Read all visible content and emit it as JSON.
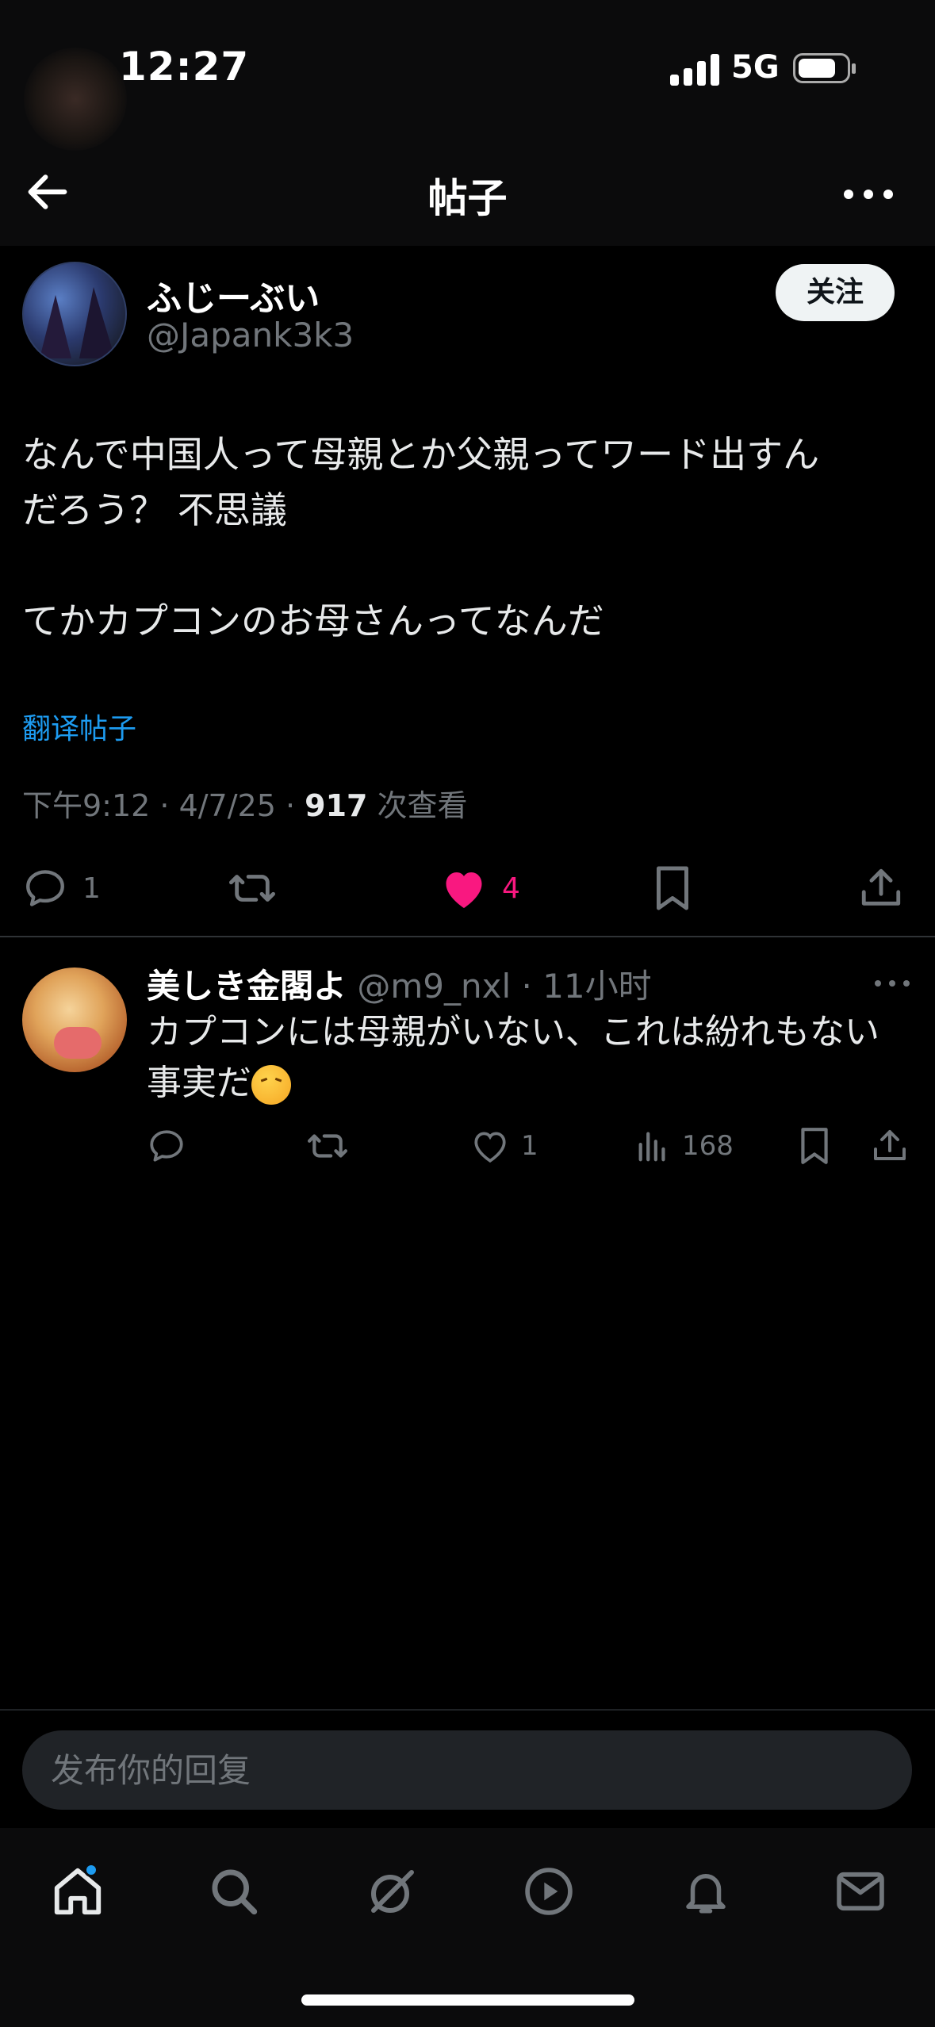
{
  "status_bar": {
    "time": "12:27",
    "network": "5G"
  },
  "header": {
    "title": "帖子"
  },
  "post": {
    "author_name": "ふじーぶい",
    "author_handle": "@Japank3k3",
    "follow_label": "关注",
    "text_line1": "なんで中国人って母親とか父親ってワード出すん",
    "text_line2": "だろう？ 不思議",
    "text_line3": "てかカプコンのお母さんってなんだ",
    "translate_label": "翻译帖子",
    "time": "下午9:12 · 4/7/25 · ",
    "views": "917",
    "views_label": " 次查看",
    "reply_count": "1",
    "like_count": "4"
  },
  "reply": {
    "name": "美しき金閣よ",
    "handle": " @m9_nxl · 11小时",
    "text": "カプコンには母親がいない、これは紛れもない事実だ",
    "like_count": "1",
    "view_count": "168"
  },
  "composer": {
    "placeholder": "发布你的回复"
  },
  "icons": {
    "back": "arrow-left-icon",
    "more": "more-horizontal-icon",
    "reply": "comment-icon",
    "repost": "repost-icon",
    "like": "heart-icon",
    "bookmark": "bookmark-icon",
    "share": "share-icon",
    "views": "bar-chart-icon"
  },
  "colors": {
    "accent": "#1d9bf0",
    "like": "#f91880",
    "muted": "#71767b"
  }
}
